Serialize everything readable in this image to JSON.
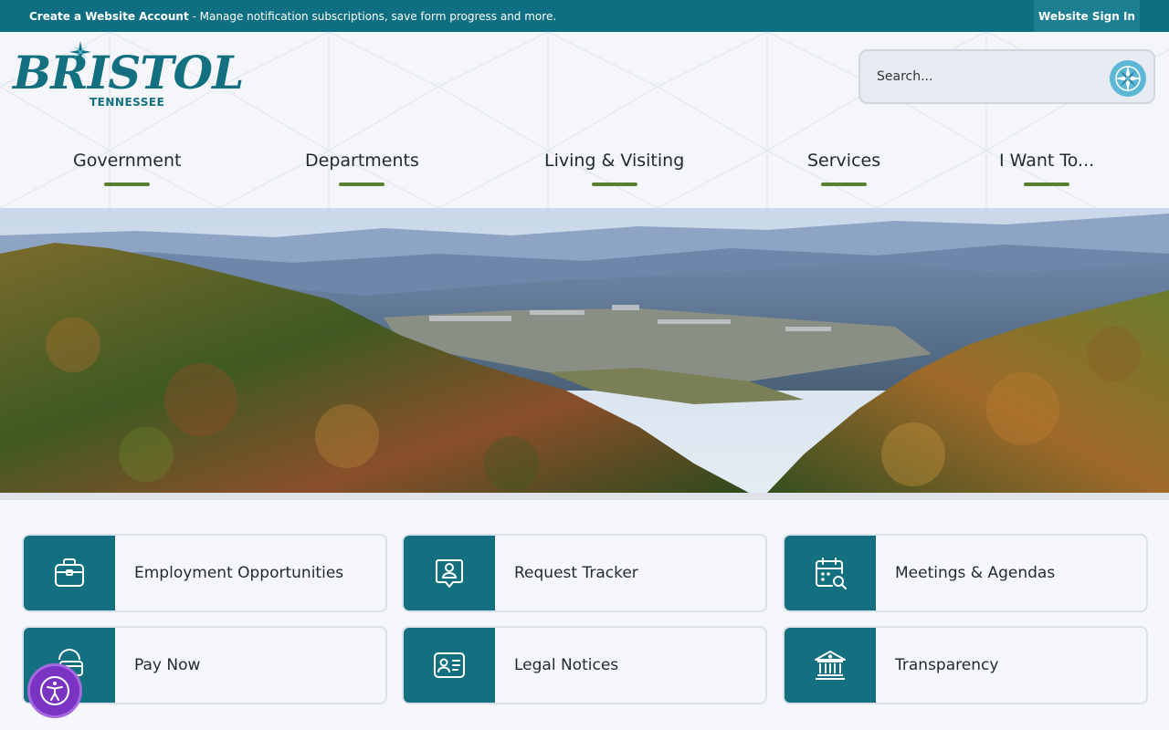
{
  "topbar": {
    "create_bold": "Create a Website Account",
    "create_rest": " - Manage notification subscriptions, save form progress and more.",
    "signin_label": "Website Sign In"
  },
  "logo": {
    "word": "BRISTOL",
    "state": "TENNESSEE",
    "tm": "™"
  },
  "search": {
    "placeholder": "Search..."
  },
  "nav": {
    "items": [
      {
        "label": "Government"
      },
      {
        "label": "Departments"
      },
      {
        "label": "Living & Visiting"
      },
      {
        "label": "Services"
      },
      {
        "label": "I Want To..."
      }
    ]
  },
  "quick_links": [
    {
      "label": "Employment Opportunities",
      "icon": "briefcase-icon"
    },
    {
      "label": "Request Tracker",
      "icon": "person-badge-icon"
    },
    {
      "label": "Meetings & Agendas",
      "icon": "calendar-search-icon"
    },
    {
      "label": "Pay Now",
      "icon": "credit-card-icon"
    },
    {
      "label": "Legal Notices",
      "icon": "id-card-icon"
    },
    {
      "label": "Transparency",
      "icon": "government-building-icon"
    }
  ],
  "colors": {
    "brand_teal": "#127080",
    "topbar": "#0f6f82",
    "nav_accent": "#5a7f2e",
    "search_button": "#5bb7d5",
    "accessibility": "#7b33c4"
  }
}
